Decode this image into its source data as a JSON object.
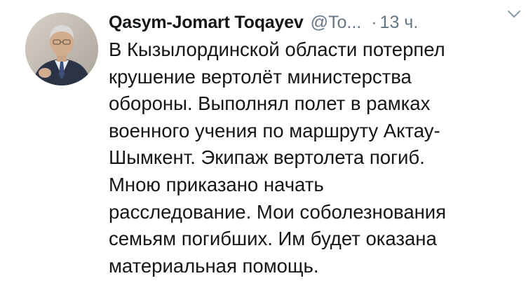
{
  "tweet": {
    "author_name": "Qasym-Jomart Toqayev",
    "handle": "@To...",
    "separator": "·",
    "time": "13 ч.",
    "lines": [
      "В Кызылординской области потерпел",
      "крушение вертолёт министерства",
      "обороны. Выполнял полет в рамках",
      "военного учения по маршруту Актау-",
      "Шымкент. Экипаж вертолета погиб.",
      "Мною приказано начать",
      "расследование. Мои соболезнования",
      "семьям погибших. Им будет оказана",
      "материальная помощь."
    ]
  },
  "icons": {
    "avatar": "profile-photo",
    "menu": "chevron-down-icon"
  },
  "colors": {
    "name": "#14171a",
    "secondary": "#657786",
    "background": "#ffffff"
  }
}
